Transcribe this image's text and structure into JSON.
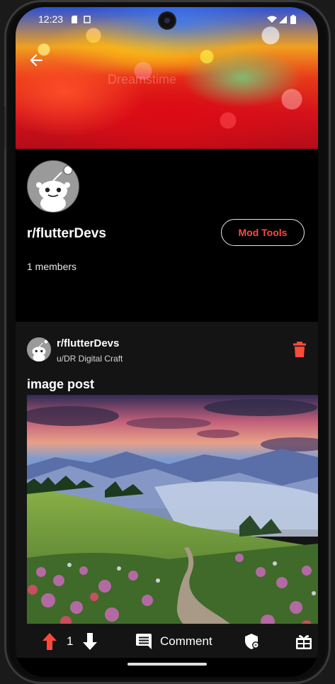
{
  "status_bar": {
    "time": "12:23"
  },
  "banner": {
    "watermark": "Dreamstime"
  },
  "community": {
    "name": "r/flutterDevs",
    "members_text": "1 members",
    "mod_tools_label": "Mod Tools"
  },
  "post": {
    "community": "r/flutterDevs",
    "author": "u/DR Digital Craft",
    "title": "image post"
  },
  "actions": {
    "vote_count": "1",
    "comment_label": "Comment"
  },
  "colors": {
    "accent": "#ff4a3a",
    "background": "#000000",
    "card": "#141414",
    "upvote": "#ff4a3a"
  },
  "icons": [
    "back-arrow-icon",
    "trash-icon",
    "upvote-arrow-icon",
    "downvote-arrow-icon",
    "comment-icon",
    "mod-shield-icon",
    "gift-icon"
  ]
}
